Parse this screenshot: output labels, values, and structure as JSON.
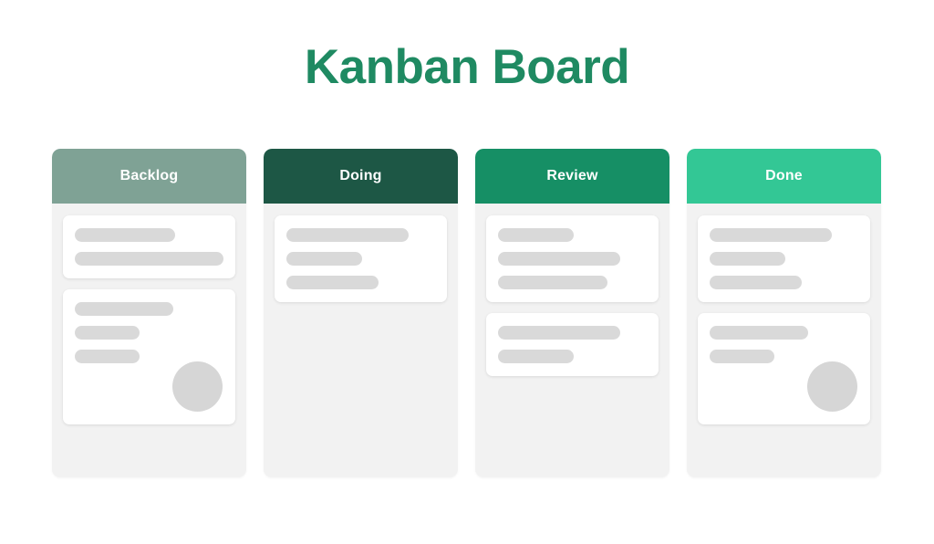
{
  "page": {
    "title": "Kanban Board",
    "background": "#ffffff",
    "title_color": "#1f8a62"
  },
  "board": {
    "column_body_color": "#f2f2f2",
    "card_color": "#ffffff",
    "placeholder_bar_color": "#d9d9d9",
    "avatar_color": "#d6d6d6",
    "columns": [
      {
        "id": "backlog",
        "label": "Backlog",
        "header_color": "#7fa295",
        "cards": [
          {
            "id": "backlog-card-1",
            "has_avatar": false,
            "bars": [
              110,
              163
            ]
          },
          {
            "id": "backlog-card-2",
            "has_avatar": true,
            "bars": [
              108,
              71,
              71
            ]
          }
        ]
      },
      {
        "id": "doing",
        "label": "Doing",
        "header_color": "#1d5745",
        "cards": [
          {
            "id": "doing-card-1",
            "has_avatar": false,
            "bars": [
              134,
              83,
              101
            ]
          }
        ]
      },
      {
        "id": "review",
        "label": "Review",
        "header_color": "#168f65",
        "cards": [
          {
            "id": "review-card-1",
            "has_avatar": false,
            "bars": [
              83,
              134,
              120
            ]
          },
          {
            "id": "review-card-2",
            "has_avatar": false,
            "bars": [
              134,
              83
            ]
          }
        ]
      },
      {
        "id": "done",
        "label": "Done",
        "header_color": "#33c795",
        "cards": [
          {
            "id": "done-card-1",
            "has_avatar": false,
            "bars": [
              134,
              83,
              101
            ]
          },
          {
            "id": "done-card-2",
            "has_avatar": true,
            "bars": [
              108,
              71
            ]
          }
        ]
      }
    ]
  }
}
